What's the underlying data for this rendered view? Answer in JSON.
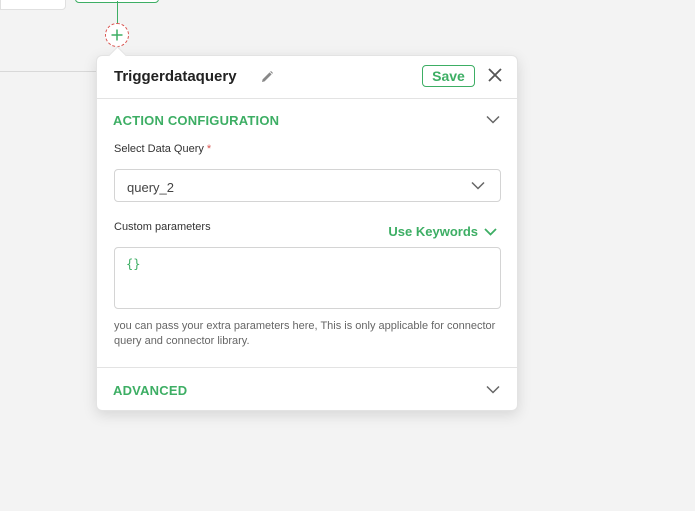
{
  "panel": {
    "title": "Triggerdataquery",
    "save_label": "Save",
    "action_section": {
      "title": "ACTION CONFIGURATION",
      "select_label": "Select Data Query",
      "required_mark": "*",
      "select_value": "query_2",
      "params_label": "Custom parameters",
      "use_keywords_label": "Use Keywords",
      "params_value": "{}",
      "help_text": "you can pass your extra parameters here, This is only applicable for connector query and connector library."
    },
    "advanced_section": {
      "title": "ADVANCED"
    }
  },
  "icons": {
    "edit": "pencil-icon",
    "close": "close-icon",
    "add": "plus-icon",
    "chevron": "chevron-down-icon"
  },
  "colors": {
    "accent": "#3dae64",
    "required": "#d9534f",
    "border": "#d4d4d4"
  }
}
